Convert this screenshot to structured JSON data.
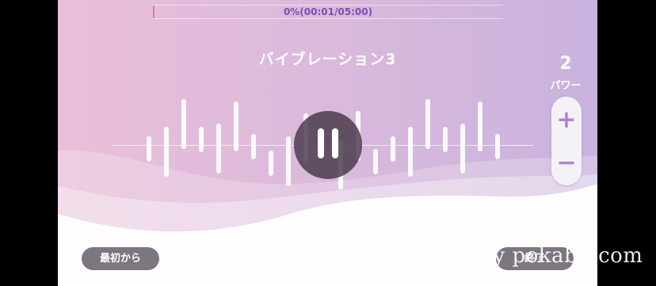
{
  "player": {
    "progress_text": "0%(00:01/05:00)",
    "progress_fraction": 0.0033,
    "title": "バイブレーション3",
    "state": "playing",
    "pause_icon": "pause-icon"
  },
  "power": {
    "value": "2",
    "label": "パワー",
    "plus_label": "+",
    "minus_label": "−"
  },
  "buttons": {
    "restart_label": "最初から",
    "exit_label": "終了"
  },
  "watermark": {
    "text": "copyright by pokabb.com"
  },
  "colors": {
    "accent": "#b282d6",
    "progress_fill": "#e8768f",
    "button_bg": "#7d7580"
  }
}
